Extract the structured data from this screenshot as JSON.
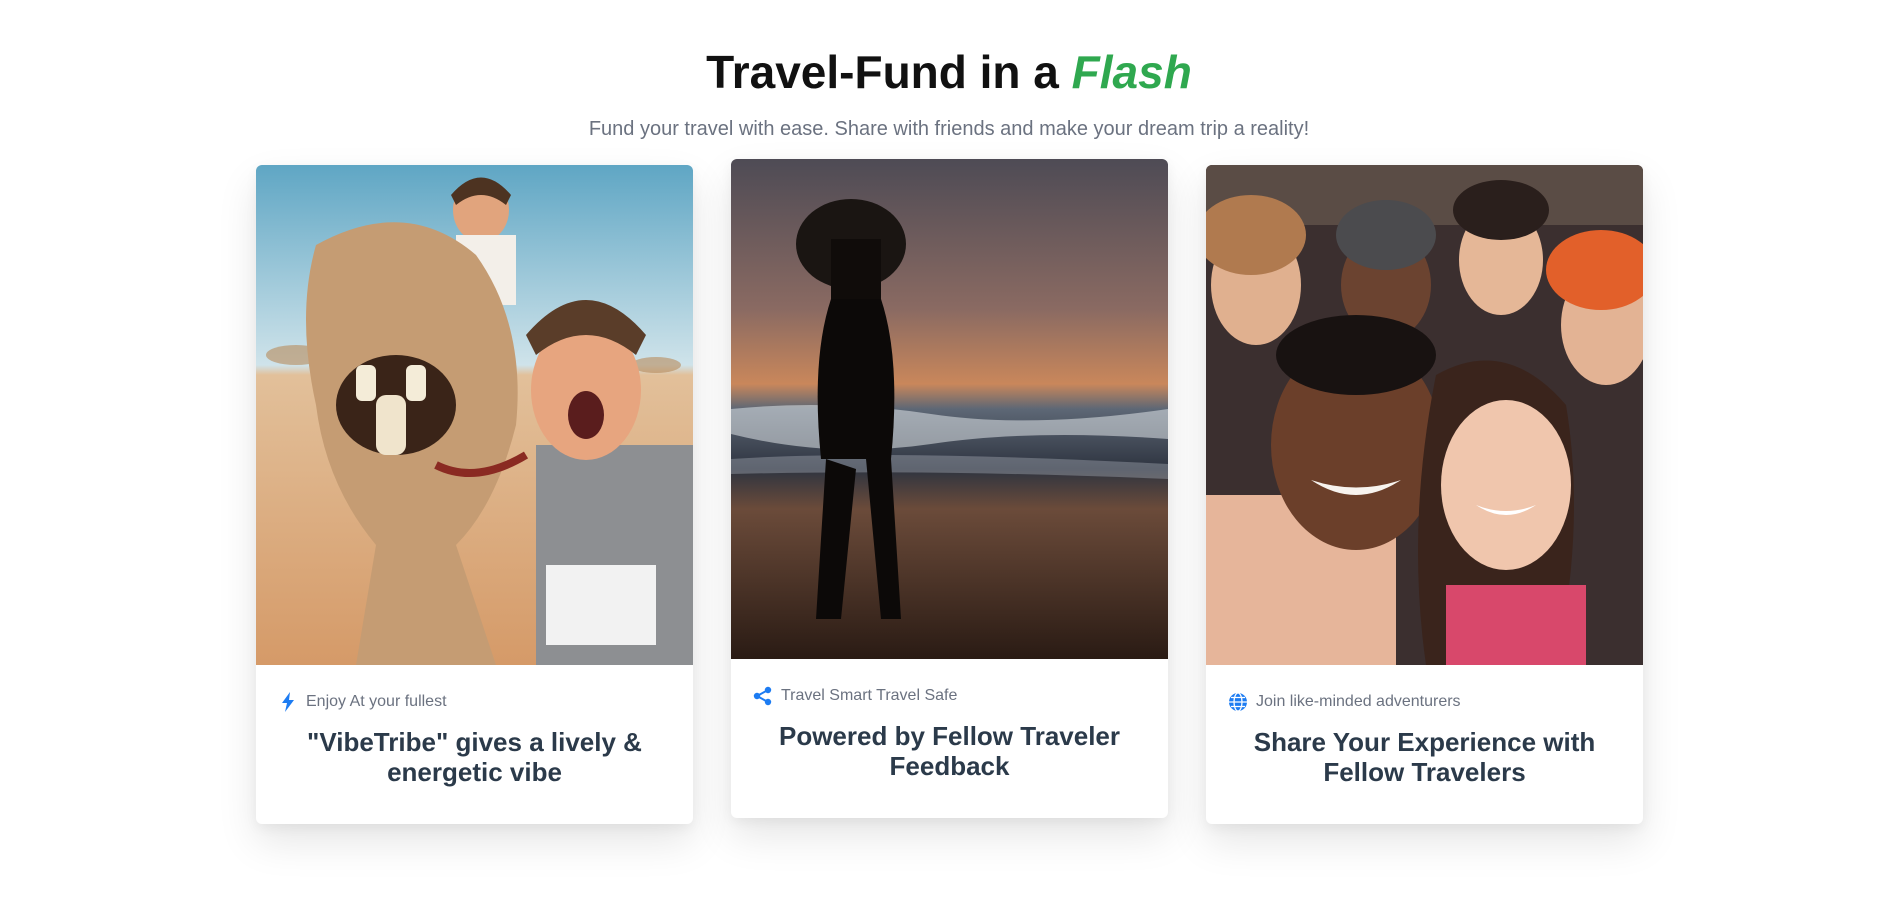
{
  "header": {
    "title_main": "Travel-Fund in a ",
    "title_accent": "Flash",
    "subtitle": "Fund your travel with ease. Share with friends and make your dream trip a reality!"
  },
  "colors": {
    "accent_green": "#2fa84f",
    "icon_blue": "#1d7cf2",
    "heading_text": "#2b3a4a",
    "muted_text": "#6b7280"
  },
  "cards": [
    {
      "image": "desert-camel-selfie-photo",
      "icon": "bolt-icon",
      "tag": "Enjoy At your fullest",
      "heading": "\"VibeTribe\" gives a lively & energetic vibe"
    },
    {
      "image": "beach-sunset-silhouette-photo",
      "icon": "share-icon",
      "tag": "Travel Smart Travel Safe",
      "heading": "Powered by Fellow Traveler Feedback"
    },
    {
      "image": "group-friends-selfie-photo",
      "icon": "globe-icon",
      "tag": "Join like-minded adventurers",
      "heading": "Share Your Experience with Fellow Travelers"
    }
  ]
}
